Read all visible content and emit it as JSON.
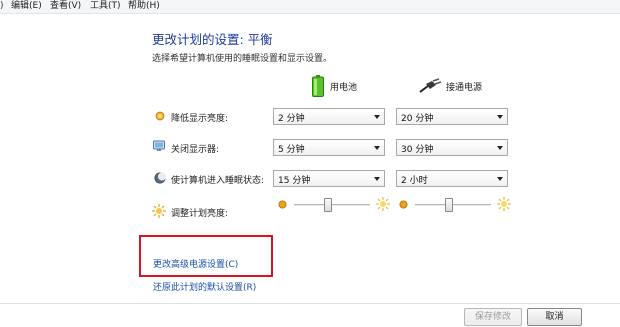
{
  "menubar": {
    "separator": ")",
    "items": [
      "编辑(E)",
      "查看(V)",
      "工具(T)",
      "帮助(H)"
    ]
  },
  "header": {
    "title": "更改计划的设置: 平衡",
    "subtitle": "选择希望计算机使用的睡眠设置和显示设置。"
  },
  "columns": {
    "battery": "用电池",
    "plugged": "接通电源"
  },
  "rows": [
    {
      "label": "降低显示亮度:",
      "icon": "dim-display-icon",
      "battery": "2 分钟",
      "plugged": "20 分钟"
    },
    {
      "label": "关闭显示器:",
      "icon": "monitor-icon",
      "battery": "5 分钟",
      "plugged": "30 分钟"
    },
    {
      "label": "使计算机进入睡眠状态:",
      "icon": "sleep-moon-icon",
      "battery": "15 分钟",
      "plugged": "2 小时"
    }
  ],
  "brightness": {
    "label": "调整计划亮度:",
    "battery_level": 0.45,
    "plugged_level": 0.45
  },
  "links": {
    "advanced": "更改高级电源设置(C)",
    "restore": "还原此计划的默认设置(R)"
  },
  "buttons": {
    "save": "保存修改",
    "cancel": "取消"
  },
  "colors": {
    "title": "#1e3a9a",
    "link": "#1a4fa8",
    "highlight_box": "#d8141e"
  }
}
